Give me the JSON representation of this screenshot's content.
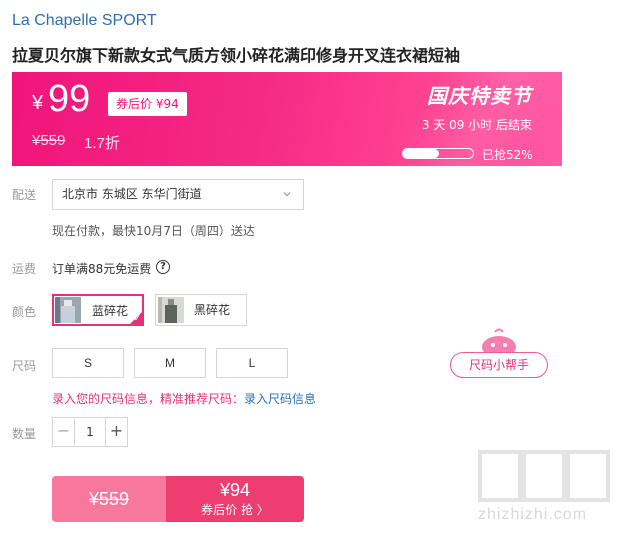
{
  "brand": "La Chapelle SPORT",
  "product_title": "拉夏贝尔旗下新款女式气质方领小碎花满印修身开叉连衣裙短袖",
  "banner": {
    "currency": "¥",
    "price": "99",
    "coupon_tag": "券后价 ¥94",
    "original_price": "¥559",
    "discount": "1.7折",
    "event_title": "国庆特卖节",
    "countdown": "3 天 09 小时 后结束",
    "progress_text": "已抢52%",
    "progress_value": 0.52
  },
  "delivery": {
    "label": "配送",
    "address": "北京市 东城区 东华门街道",
    "eta": "现在付款，最快10月7日（周四）送达"
  },
  "shipping": {
    "label": "运费",
    "text": "订单满88元免运费",
    "help_icon": "?"
  },
  "color": {
    "label": "颜色",
    "options": [
      {
        "label": "蓝碎花",
        "selected": true
      },
      {
        "label": "黑碎花",
        "selected": false
      }
    ],
    "check_mark": "✓"
  },
  "size": {
    "label": "尺码",
    "options": [
      "S",
      "M",
      "L"
    ],
    "helper_label": "尺码小帮手",
    "info_text": "录入您的尺码信息，精准推荐尺码：",
    "info_link": "录入尺码信息"
  },
  "quantity": {
    "label": "数量",
    "value": "1",
    "minus": "−",
    "plus": "+"
  },
  "buy": {
    "original_price": "¥559",
    "price": "¥94",
    "cta": "券后价 抢 〉"
  },
  "watermark": {
    "text": "zhizhizhi.com"
  },
  "colors": {
    "accent": "#e5317a",
    "banner": "#f0147a",
    "link": "#2a6fb5"
  }
}
